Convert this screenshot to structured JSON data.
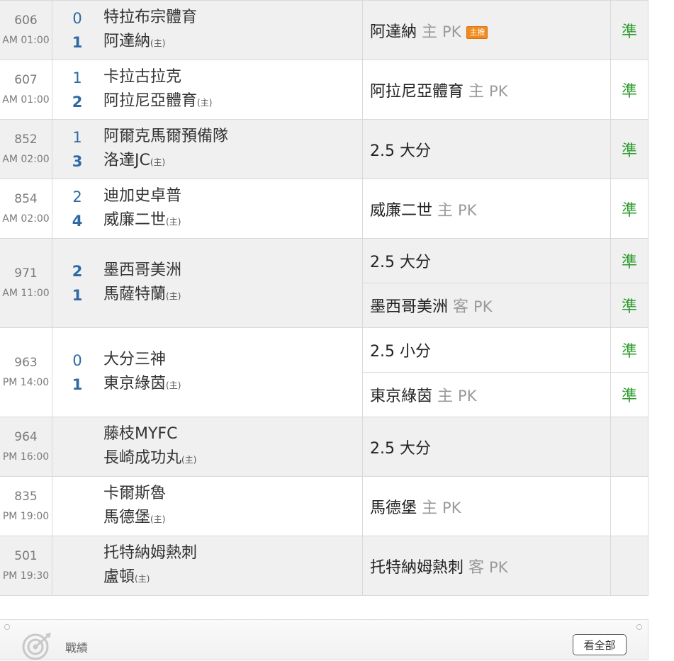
{
  "home_marker": "(主)",
  "recommend_badge": "主推",
  "matches": [
    {
      "id": "606",
      "time": "AM 01:00",
      "score_away": "0",
      "score_home": "1",
      "away": "特拉布宗體育",
      "home": "阿達納",
      "tips": [
        {
          "pick": "阿達納",
          "side": "主",
          "line": "PK",
          "badge": true,
          "result": "準"
        }
      ]
    },
    {
      "id": "607",
      "time": "AM 01:00",
      "score_away": "1",
      "score_home": "2",
      "away": "卡拉古拉克",
      "home": "阿拉尼亞體育",
      "tips": [
        {
          "pick": "阿拉尼亞體育",
          "side": "主",
          "line": "PK",
          "result": "準"
        }
      ]
    },
    {
      "id": "852",
      "time": "AM 02:00",
      "score_away": "1",
      "score_home": "3",
      "away": "阿爾克馬爾預備隊",
      "home": "洛達JC",
      "tips": [
        {
          "pick": "2.5 大分",
          "result": "準"
        }
      ]
    },
    {
      "id": "854",
      "time": "AM 02:00",
      "score_away": "2",
      "score_home": "4",
      "away": "迪加史卓普",
      "home": "威廉二世",
      "tips": [
        {
          "pick": "威廉二世",
          "side": "主",
          "line": "PK",
          "result": "準"
        }
      ]
    },
    {
      "id": "971",
      "time": "AM 11:00",
      "score_away": "2",
      "score_home": "1",
      "away": "墨西哥美洲",
      "home": "馬薩特蘭",
      "tips": [
        {
          "pick": "2.5 大分",
          "result": "準"
        },
        {
          "pick": "墨西哥美洲",
          "side": "客",
          "line": "PK",
          "result": "準"
        }
      ]
    },
    {
      "id": "963",
      "time": "PM 14:00",
      "score_away": "0",
      "score_home": "1",
      "away": "大分三神",
      "home": "東京綠茵",
      "tips": [
        {
          "pick": "2.5 小分",
          "result": "準"
        },
        {
          "pick": "東京綠茵",
          "side": "主",
          "line": "PK",
          "result": "準"
        }
      ]
    },
    {
      "id": "964",
      "time": "PM 16:00",
      "score_away": "",
      "score_home": "",
      "away": "藤枝MYFC",
      "home": "長崎成功丸",
      "tips": [
        {
          "pick": "2.5 大分",
          "result": ""
        }
      ]
    },
    {
      "id": "835",
      "time": "PM 19:00",
      "score_away": "",
      "score_home": "",
      "away": "卡爾斯魯",
      "home": "馬德堡",
      "tips": [
        {
          "pick": "馬德堡",
          "side": "主",
          "line": "PK",
          "result": ""
        }
      ]
    },
    {
      "id": "501",
      "time": "PM 19:30",
      "score_away": "",
      "score_home": "",
      "away": "托特納姆熱刺",
      "home": "盧頓",
      "tips": [
        {
          "pick": "托特納姆熱刺",
          "side": "客",
          "line": "PK",
          "result": ""
        }
      ]
    }
  ],
  "footer": {
    "label": "戰績",
    "view_all": "看全部",
    "icon": "target-icon"
  }
}
